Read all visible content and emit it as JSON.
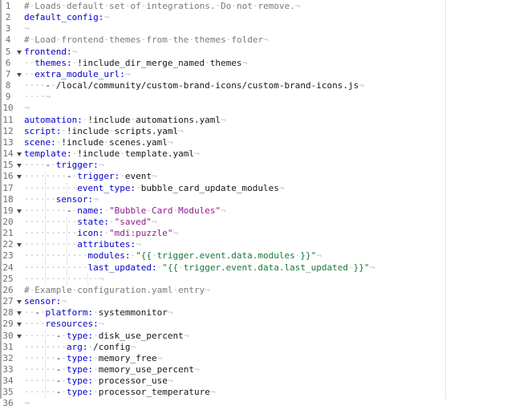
{
  "editor": {
    "description": "YAML configuration file open in a code editor with line numbers, fold arrows, visible whitespace dots and end-of-line marks",
    "whitespace_dot": "·",
    "eol_mark": "¬",
    "colors": {
      "key": "#0000cc",
      "plain": "#161616",
      "string": "#8e1b8e",
      "template_string": "#157a36",
      "comment": "#7a7a7a",
      "line_number": "#6e6e6e",
      "invisibles": "#c2c2c2",
      "print_margin": "#e4e4e4"
    },
    "lines": [
      {
        "n": 1,
        "fold": false,
        "tokens": [
          [
            "c",
            "# Loads default set of integrations. Do not remove."
          ]
        ]
      },
      {
        "n": 2,
        "fold": false,
        "tokens": [
          [
            "k",
            "default_config:"
          ]
        ]
      },
      {
        "n": 3,
        "fold": false,
        "tokens": []
      },
      {
        "n": 4,
        "fold": false,
        "tokens": [
          [
            "c",
            "# Load frontend themes from the themes folder"
          ]
        ]
      },
      {
        "n": 5,
        "fold": true,
        "tokens": [
          [
            "k",
            "frontend:"
          ]
        ]
      },
      {
        "n": 6,
        "fold": false,
        "tokens": [
          [
            "w",
            2
          ],
          [
            "k",
            "themes:"
          ],
          [
            "t",
            " !include_dir_merge_named themes"
          ]
        ]
      },
      {
        "n": 7,
        "fold": true,
        "tokens": [
          [
            "w",
            2
          ],
          [
            "k",
            "extra_module_url:"
          ]
        ]
      },
      {
        "n": 8,
        "fold": false,
        "tokens": [
          [
            "w",
            4
          ],
          [
            "t",
            "- /local/community/custom-brand-icons/custom-brand-icons.js"
          ]
        ]
      },
      {
        "n": 9,
        "fold": false,
        "tokens": [
          [
            "w",
            4
          ]
        ]
      },
      {
        "n": 10,
        "fold": false,
        "tokens": []
      },
      {
        "n": 11,
        "fold": false,
        "tokens": [
          [
            "k",
            "automation:"
          ],
          [
            "t",
            " !include automations.yaml"
          ]
        ]
      },
      {
        "n": 12,
        "fold": false,
        "tokens": [
          [
            "k",
            "script:"
          ],
          [
            "t",
            " !include scripts.yaml"
          ]
        ]
      },
      {
        "n": 13,
        "fold": false,
        "tokens": [
          [
            "k",
            "scene:"
          ],
          [
            "t",
            " !include scenes.yaml"
          ]
        ]
      },
      {
        "n": 14,
        "fold": true,
        "tokens": [
          [
            "k",
            "template:"
          ],
          [
            "t",
            " !include template.yaml"
          ]
        ]
      },
      {
        "n": 15,
        "fold": true,
        "tokens": [
          [
            "w",
            4
          ],
          [
            "t",
            "- "
          ],
          [
            "k",
            "trigger:"
          ]
        ]
      },
      {
        "n": 16,
        "fold": true,
        "tokens": [
          [
            "w",
            8
          ],
          [
            "t",
            "- "
          ],
          [
            "k",
            "trigger:"
          ],
          [
            "t",
            " event"
          ]
        ]
      },
      {
        "n": 17,
        "fold": false,
        "tokens": [
          [
            "w",
            10
          ],
          [
            "k",
            "event_type:"
          ],
          [
            "t",
            " bubble_card_update_modules"
          ]
        ]
      },
      {
        "n": 18,
        "fold": false,
        "tokens": [
          [
            "w",
            6
          ],
          [
            "k",
            "sensor:"
          ]
        ]
      },
      {
        "n": 19,
        "fold": true,
        "tokens": [
          [
            "w",
            8
          ],
          [
            "t",
            "- "
          ],
          [
            "k",
            "name:"
          ],
          [
            "t",
            " "
          ],
          [
            "s",
            "\"Bubble Card Modules\""
          ]
        ]
      },
      {
        "n": 20,
        "fold": false,
        "tokens": [
          [
            "w",
            10
          ],
          [
            "k",
            "state:"
          ],
          [
            "t",
            " "
          ],
          [
            "s",
            "\"saved\""
          ]
        ]
      },
      {
        "n": 21,
        "fold": false,
        "tokens": [
          [
            "w",
            10
          ],
          [
            "k",
            "icon:"
          ],
          [
            "t",
            " "
          ],
          [
            "s",
            "\"mdi:puzzle\""
          ]
        ]
      },
      {
        "n": 22,
        "fold": true,
        "tokens": [
          [
            "w",
            10
          ],
          [
            "k",
            "attributes:"
          ]
        ]
      },
      {
        "n": 23,
        "fold": false,
        "tokens": [
          [
            "w",
            12
          ],
          [
            "k",
            "modules:"
          ],
          [
            "t",
            " "
          ],
          [
            "g",
            "\"{{ trigger.event.data.modules }}\""
          ]
        ]
      },
      {
        "n": 24,
        "fold": false,
        "tokens": [
          [
            "w",
            12
          ],
          [
            "k",
            "last_updated:"
          ],
          [
            "t",
            " "
          ],
          [
            "g",
            "\"{{ trigger.event.data.last_updated }}\""
          ]
        ]
      },
      {
        "n": 25,
        "fold": false,
        "tokens": [
          [
            "w",
            14
          ]
        ]
      },
      {
        "n": 26,
        "fold": false,
        "tokens": [
          [
            "c",
            "# Example configuration.yaml entry"
          ]
        ]
      },
      {
        "n": 27,
        "fold": true,
        "tokens": [
          [
            "k",
            "sensor:"
          ]
        ]
      },
      {
        "n": 28,
        "fold": true,
        "tokens": [
          [
            "w",
            2
          ],
          [
            "t",
            "- "
          ],
          [
            "k",
            "platform:"
          ],
          [
            "t",
            " systemmonitor"
          ]
        ]
      },
      {
        "n": 29,
        "fold": true,
        "tokens": [
          [
            "w",
            4
          ],
          [
            "k",
            "resources:"
          ]
        ]
      },
      {
        "n": 30,
        "fold": true,
        "tokens": [
          [
            "w",
            6
          ],
          [
            "t",
            "- "
          ],
          [
            "k",
            "type:"
          ],
          [
            "t",
            " disk_use_percent"
          ]
        ]
      },
      {
        "n": 31,
        "fold": false,
        "tokens": [
          [
            "w",
            8
          ],
          [
            "k",
            "arg:"
          ],
          [
            "t",
            " /config"
          ]
        ]
      },
      {
        "n": 32,
        "fold": false,
        "tokens": [
          [
            "w",
            6
          ],
          [
            "t",
            "- "
          ],
          [
            "k",
            "type:"
          ],
          [
            "t",
            " memory_free"
          ]
        ]
      },
      {
        "n": 33,
        "fold": false,
        "tokens": [
          [
            "w",
            6
          ],
          [
            "t",
            "- "
          ],
          [
            "k",
            "type:"
          ],
          [
            "t",
            " memory_use_percent"
          ]
        ]
      },
      {
        "n": 34,
        "fold": false,
        "tokens": [
          [
            "w",
            6
          ],
          [
            "t",
            "- "
          ],
          [
            "k",
            "type:"
          ],
          [
            "t",
            " processor_use"
          ]
        ]
      },
      {
        "n": 35,
        "fold": false,
        "tokens": [
          [
            "w",
            6
          ],
          [
            "t",
            "- "
          ],
          [
            "k",
            "type:"
          ],
          [
            "t",
            " processor_temperature"
          ]
        ]
      },
      {
        "n": 36,
        "fold": false,
        "tokens": []
      }
    ]
  }
}
